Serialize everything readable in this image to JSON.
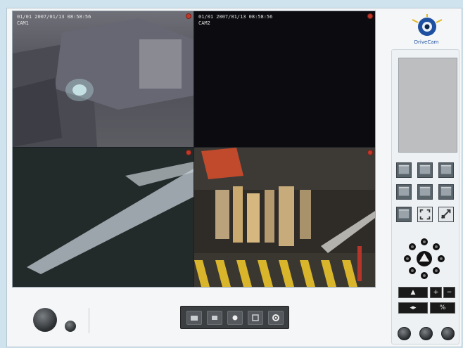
{
  "app": {
    "logo_text": "DriveCam"
  },
  "cameras": [
    {
      "osd_line1": "01/01 2007/01/13 08:58:56",
      "osd_line2": "CAM1"
    },
    {
      "osd_line1": "01/01 2007/01/13 08:58:56",
      "osd_line2": "CAM2"
    },
    {
      "osd_line1": "",
      "osd_line2": ""
    },
    {
      "osd_line1": "",
      "osd_line2": ""
    }
  ],
  "ptz": {
    "center_icon": "ptz-center-icon"
  },
  "controls": {
    "zoom_in_label": "+",
    "zoom_out_label": "−",
    "focus_label": "◂▸",
    "iris_label": "%"
  },
  "colors": {
    "record": "#c0392b",
    "panel": "#eef1f3",
    "background": "#cfe3ee"
  }
}
